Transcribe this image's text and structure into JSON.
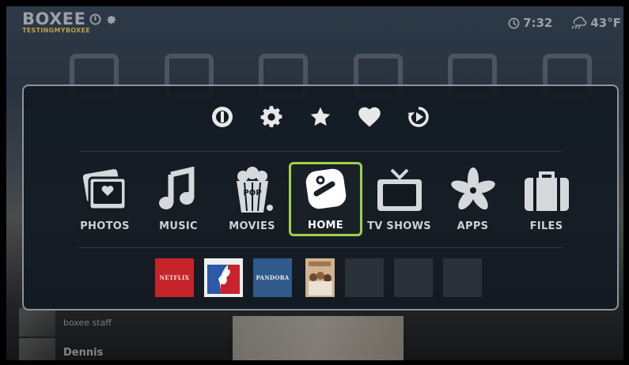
{
  "header": {
    "brand": "BOXEE",
    "user": "TESTINGMYBOXEE",
    "time": "7:32",
    "weather": "43°F"
  },
  "background": {
    "feed_user_1": "boxee staff",
    "feed_user_2": "Dennis"
  },
  "quick_actions": [
    {
      "icon": "power-icon"
    },
    {
      "icon": "gear-icon"
    },
    {
      "icon": "star-icon"
    },
    {
      "icon": "heart-icon"
    },
    {
      "icon": "history-icon"
    }
  ],
  "nav": {
    "selected": "HOME",
    "items": [
      {
        "label": "PHOTOS",
        "icon": "photos-icon"
      },
      {
        "label": "MUSIC",
        "icon": "music-note-icon"
      },
      {
        "label": "MOVIES",
        "icon": "popcorn-icon"
      },
      {
        "label": "HOME",
        "icon": "boxee-home-icon"
      },
      {
        "label": "TV SHOWS",
        "icon": "tv-icon"
      },
      {
        "label": "APPS",
        "icon": "apps-flower-icon"
      },
      {
        "label": "FILES",
        "icon": "briefcase-icon"
      }
    ],
    "popcorn_text": "POP"
  },
  "app_tiles": [
    {
      "name": "netflix",
      "label": "NETFLIX"
    },
    {
      "name": "mlb",
      "label": ""
    },
    {
      "name": "pandora",
      "label": "PANDORA"
    },
    {
      "name": "tv-show",
      "label": ""
    },
    {
      "name": "empty",
      "label": ""
    },
    {
      "name": "empty",
      "label": ""
    },
    {
      "name": "empty",
      "label": ""
    }
  ],
  "colors": {
    "accent_green": "#9ed14a",
    "brand_gold": "#b7a245",
    "netflix_red": "#c6232a",
    "pandora_blue": "#2f5a8a"
  }
}
